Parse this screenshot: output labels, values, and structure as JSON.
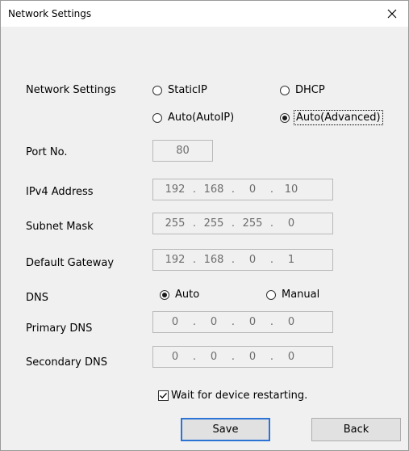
{
  "window": {
    "title": "Network Settings"
  },
  "network_settings": {
    "label": "Network Settings",
    "options": [
      {
        "label": "StaticIP",
        "checked": false
      },
      {
        "label": "DHCP",
        "checked": false
      },
      {
        "label": "Auto(AutoIP)",
        "checked": false
      },
      {
        "label": "Auto(Advanced)",
        "checked": true
      }
    ]
  },
  "port": {
    "label": "Port No.",
    "value": "80"
  },
  "ipv4": {
    "label": "IPv4 Address",
    "octets": [
      "192",
      "168",
      "0",
      "10"
    ]
  },
  "subnet": {
    "label": "Subnet Mask",
    "octets": [
      "255",
      "255",
      "255",
      "0"
    ]
  },
  "gateway": {
    "label": "Default Gateway",
    "octets": [
      "192",
      "168",
      "0",
      "1"
    ]
  },
  "dns": {
    "label": "DNS",
    "options": [
      {
        "label": "Auto",
        "checked": true
      },
      {
        "label": "Manual",
        "checked": false
      }
    ]
  },
  "primary_dns": {
    "label": "Primary DNS",
    "octets": [
      "0",
      "0",
      "0",
      "0"
    ]
  },
  "secondary_dns": {
    "label": "Secondary DNS",
    "octets": [
      "0",
      "0",
      "0",
      "0"
    ]
  },
  "wait_restart": {
    "label": "Wait for device restarting.",
    "checked": true
  },
  "buttons": {
    "save": "Save",
    "back": "Back"
  },
  "colors": {
    "default_button_border": "#2b74d6",
    "disabled_text": "#6d6d6d"
  }
}
